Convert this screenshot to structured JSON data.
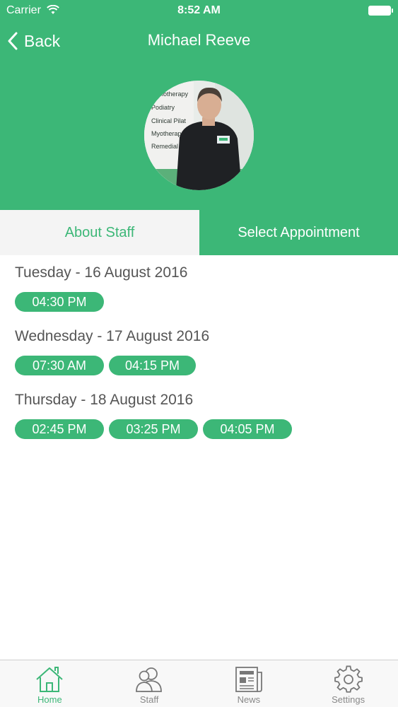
{
  "status_bar": {
    "carrier": "Carrier",
    "time": "8:52 AM"
  },
  "nav": {
    "back_label": "Back",
    "title": "Michael Reeve"
  },
  "avatar": {
    "sign_lines": [
      "ysiotherapy",
      "Podiatry",
      "Clinical Pilat",
      "Myotherap",
      "Remedial N"
    ]
  },
  "tabs": [
    {
      "label": "About Staff"
    },
    {
      "label": "Select Appointment"
    }
  ],
  "days": [
    {
      "label": "Tuesday - 16 August 2016",
      "slots": [
        "04:30 PM"
      ]
    },
    {
      "label": "Wednesday - 17 August 2016",
      "slots": [
        "07:30 AM",
        "04:15 PM"
      ]
    },
    {
      "label": "Thursday - 18 August 2016",
      "slots": [
        "02:45 PM",
        "03:25 PM",
        "04:05 PM"
      ]
    }
  ],
  "bottom_nav": [
    {
      "label": "Home",
      "icon": "home-icon",
      "active": true
    },
    {
      "label": "Staff",
      "icon": "staff-icon",
      "active": false
    },
    {
      "label": "News",
      "icon": "news-icon",
      "active": false
    },
    {
      "label": "Settings",
      "icon": "gear-icon",
      "active": false
    }
  ],
  "colors": {
    "accent": "#3cb777",
    "tab_inactive_bg": "#f4f4f4",
    "text": "#555555"
  }
}
